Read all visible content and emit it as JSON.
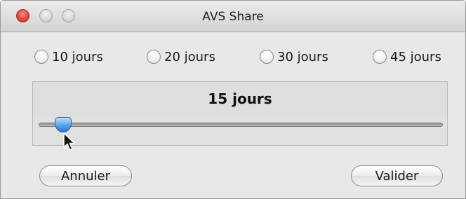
{
  "window": {
    "title": "AVS Share"
  },
  "options": [
    {
      "label": "10 jours",
      "selected": false
    },
    {
      "label": "20 jours",
      "selected": false
    },
    {
      "label": "30 jours",
      "selected": false
    },
    {
      "label": "45 jours",
      "selected": false
    }
  ],
  "slider": {
    "value_label": "15 jours",
    "fraction": 0.06
  },
  "buttons": {
    "cancel_label": "Annuler",
    "ok_label": "Valider"
  },
  "colors": {
    "accent": "#4f9de9",
    "close": "#e2463e"
  }
}
